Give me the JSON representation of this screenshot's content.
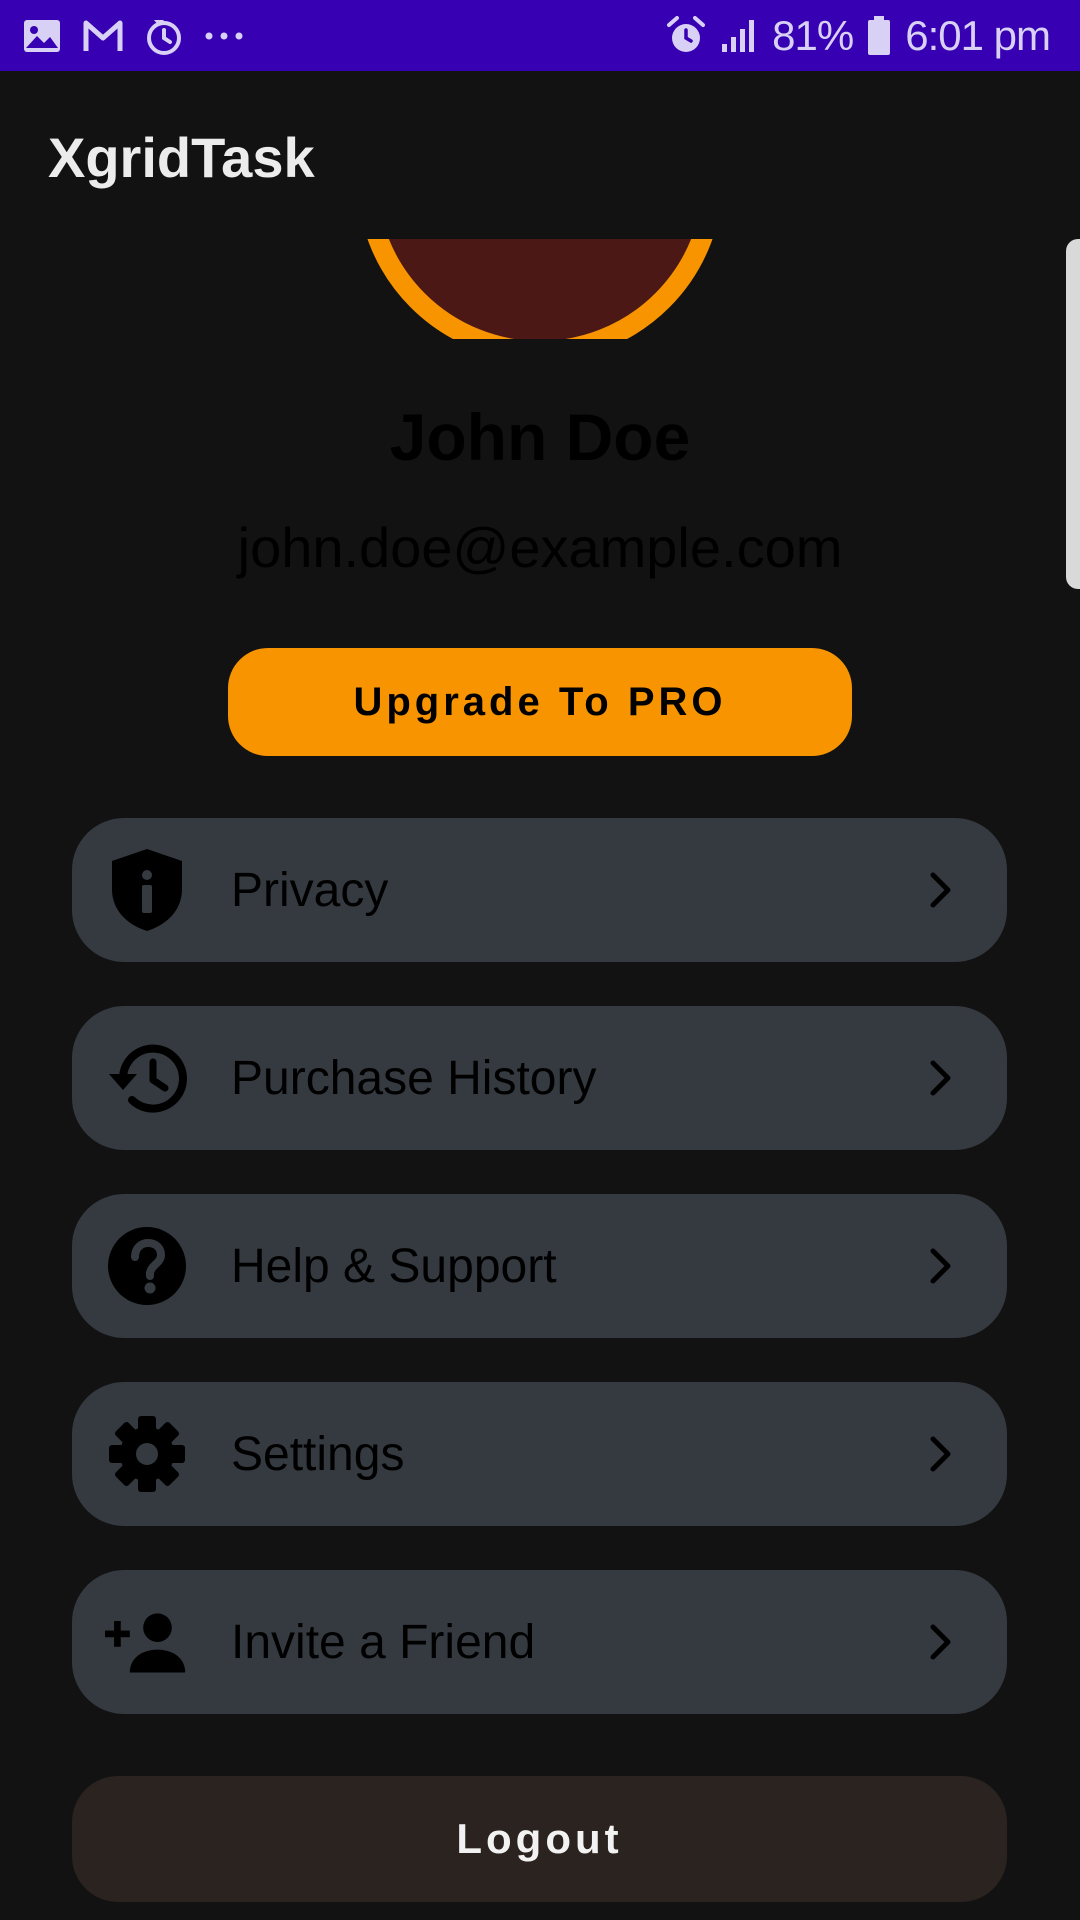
{
  "status_bar": {
    "battery_text": "81%",
    "time": "6:01 pm",
    "icons_left": [
      "image-icon",
      "gmail-icon",
      "sync-icon",
      "more-dots-icon"
    ],
    "icons_right": [
      "alarm-icon",
      "signal-icon",
      "battery-icon"
    ]
  },
  "app_bar": {
    "title": "XgridTask"
  },
  "profile": {
    "name": "John Doe",
    "email": "john.doe@example.com",
    "upgrade_label": "Upgrade To PRO"
  },
  "menu": {
    "items": [
      {
        "label": "Privacy",
        "icon": "privacy-shield-icon"
      },
      {
        "label": "Purchase History",
        "icon": "history-icon"
      },
      {
        "label": "Help & Support",
        "icon": "help-icon"
      },
      {
        "label": "Settings",
        "icon": "gear-icon"
      },
      {
        "label": "Invite a Friend",
        "icon": "add-person-icon"
      }
    ]
  },
  "logout_label": "Logout",
  "colors": {
    "status_bar": "#3700b3",
    "background": "#121212",
    "accent": "#f79400",
    "menu_item": "#343a40",
    "logout": "#2b231f",
    "avatar_fill": "#4c1816"
  }
}
